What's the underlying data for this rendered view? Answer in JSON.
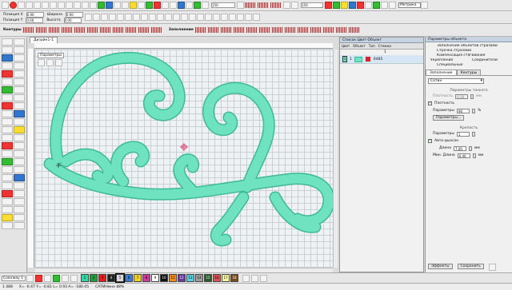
{
  "toolbar1": {
    "zoom_value": "150",
    "zoom_value_2": "150",
    "unit_select": "Метрика"
  },
  "toolbar2": {
    "position_x_label": "Позиция X",
    "position_y_label": "Позиция Y",
    "width_label": "Ширина",
    "height_label": "Высота",
    "position_x_value": "0.00",
    "position_y_value": "0.00",
    "width_value": "0.00",
    "height_value": "0.00",
    "fill_label": "Заполнение"
  },
  "toolbar3": {
    "contours_label": "Контуры"
  },
  "document": {
    "tab_label": "Дизайн1-1",
    "params_label": "Параметры"
  },
  "mid_panel": {
    "title": "Список Цвет-Объект",
    "columns": [
      "Цвет",
      "Объект",
      "Тип",
      "Стежки"
    ],
    "count_value": "1",
    "row": {
      "index": "1",
      "count": "1",
      "stitches": "6485"
    }
  },
  "right_panel": {
    "title": "Параметры объекта",
    "items": [
      "Заполнение объектов стразами",
      "Строчка стразами",
      "Компенсация стягивания",
      "Укрепление",
      "Соединители",
      "Специальные"
    ],
    "tabs": [
      "Заполнение",
      "Контуры"
    ],
    "fill_type": "Сатин",
    "group_gradient": "Параметры тонкого",
    "gradient_label": "Плотность",
    "gradient_value": "0.38",
    "gradient_unit": "мм",
    "density_checkbox": "Плотность",
    "params_label": "Параметры",
    "params_value": "90",
    "params_unit": "%",
    "params_button": "Параметры...",
    "group_strength": "Крепость",
    "strength_label": "Параметры",
    "strength_value": "1",
    "auto_split_label": "Авто-дыхсон",
    "length_label": "Длина",
    "length_value": "7.00",
    "length_unit": "мм",
    "min_length_label": "Мин. Длина",
    "min_length_value": "0.40",
    "min_length_unit": "мм",
    "effects_button": "Эффекты",
    "save_button": "Сохранить"
  },
  "palette": {
    "colorway_select": "Colorway 1",
    "swatches": [
      {
        "label": "1",
        "color": "#33d6a0"
      },
      {
        "label": "2",
        "color": "#1f9e3a"
      },
      {
        "label": "3",
        "color": "#e02020"
      },
      {
        "label": "4",
        "color": "#222222"
      },
      {
        "label": "5",
        "color": "#d9d9d9"
      },
      {
        "label": "6",
        "color": "#3a7bd5"
      },
      {
        "label": "7",
        "color": "#f0d020"
      },
      {
        "label": "8",
        "color": "#d03aa0"
      },
      {
        "label": "9",
        "color": "#ffffff"
      },
      {
        "label": "10",
        "color": "#111111"
      },
      {
        "label": "11",
        "color": "#f08a1a"
      },
      {
        "label": "12",
        "color": "#6a3aa0"
      },
      {
        "label": "13",
        "color": "#5ad0e0"
      },
      {
        "label": "14",
        "color": "#a0a0a0"
      },
      {
        "label": "15",
        "color": "#2a5a2a"
      },
      {
        "label": "16",
        "color": "#e05050"
      },
      {
        "label": "17",
        "color": "#f7f7a0"
      },
      {
        "label": "18",
        "color": "#7a4a1a"
      }
    ]
  },
  "status": {
    "left": "1 488",
    "coords": "X= -0.47 Y= -0.81 L= 0.93 A= -180.05",
    "info": "САТИНмно 88%"
  },
  "colors": {
    "embroidery": "#6fe3c0",
    "embroidery_edge": "#3fb996",
    "grid_bg": "#eef2f4",
    "panel_title": "#c8d3e2"
  }
}
